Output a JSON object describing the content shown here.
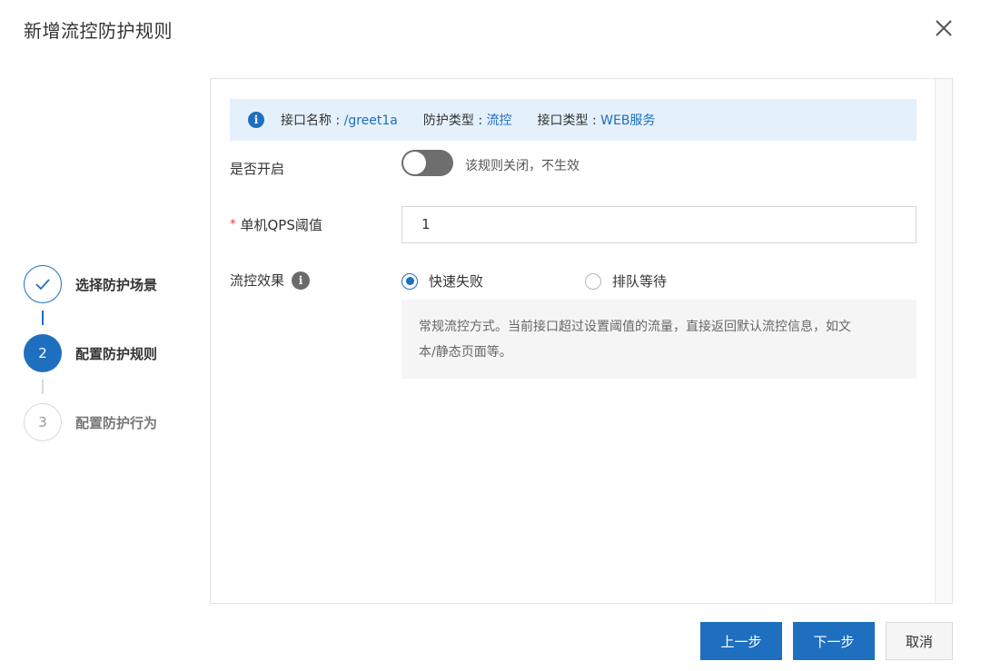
{
  "dialog": {
    "title": "新增流控防护规则",
    "close_icon": "close-icon"
  },
  "steps": [
    {
      "number": "1",
      "label": "选择防护场景",
      "status": "done",
      "icon": "check-icon"
    },
    {
      "number": "2",
      "label": "配置防护规则",
      "status": "active"
    },
    {
      "number": "3",
      "label": "配置防护行为",
      "status": "pending"
    }
  ],
  "info": {
    "icon": "info-icon",
    "api_name_label": "接口名称 : ",
    "api_name_value": "/greet1a",
    "protect_type_label": "防护类型 : ",
    "protect_type_value": "流控",
    "api_type_label": "接口类型 : ",
    "api_type_value": "WEB服务"
  },
  "form": {
    "enable_label": "是否开启",
    "enable_on": false,
    "enable_desc": "该规则关闭，不生效",
    "qps_required_mark": "*",
    "qps_label": "单机QPS阈值",
    "qps_value": "1",
    "effect_label": "流控效果",
    "effect_help_icon": "info-icon",
    "effect_options": [
      {
        "label": "快速失败",
        "checked": true
      },
      {
        "label": "排队等待",
        "checked": false
      }
    ],
    "effect_desc_line1": "常规流控方式。当前接口超过设置阈值的流量，直接返回默认流控信息，如文",
    "effect_desc_line2": "本/静态页面等。"
  },
  "footer": {
    "prev_label": "上一步",
    "next_label": "下一步",
    "cancel_label": "取消"
  },
  "colors": {
    "primary": "#1e6fbf",
    "info_bg": "#e4f0fb",
    "toggle_off": "#6e6e6e",
    "required": "#e0393e"
  }
}
